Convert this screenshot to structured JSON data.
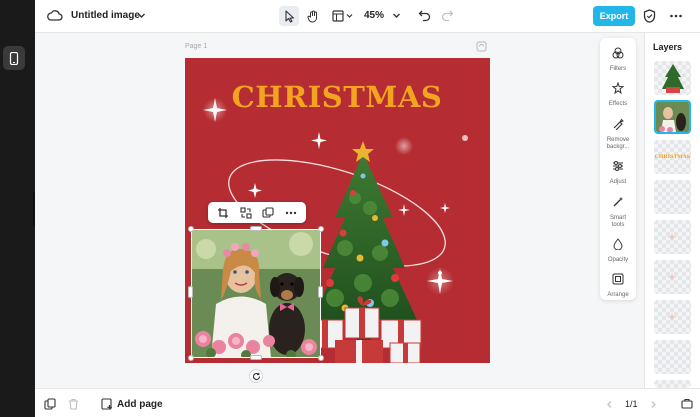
{
  "header": {
    "doc_title": "Untitled image",
    "zoom": "45%",
    "export_label": "Export"
  },
  "canvas": {
    "page_label": "Page 1",
    "design_title": "CHRISTMAS"
  },
  "tools": [
    {
      "label": "Filters",
      "icon": "filters-icon"
    },
    {
      "label": "Effects",
      "icon": "effects-icon"
    },
    {
      "label": "Remove backgr...",
      "icon": "remove-background-icon"
    },
    {
      "label": "Adjust",
      "icon": "adjust-icon"
    },
    {
      "label": "Smart tools",
      "icon": "smart-tools-icon"
    },
    {
      "label": "Opacity",
      "icon": "opacity-icon"
    },
    {
      "label": "Arrange",
      "icon": "arrange-icon"
    }
  ],
  "layers": {
    "title": "Layers",
    "items": [
      {
        "name": "christmas-tree"
      },
      {
        "name": "bride-and-dog-photo",
        "selected": true
      },
      {
        "name": "christmas-text",
        "text": "CHRISTMAS"
      },
      {
        "name": "empty-layer"
      },
      {
        "name": "sparkle-layer"
      },
      {
        "name": "sparkle-layer"
      },
      {
        "name": "sparkle-layer"
      },
      {
        "name": "empty-layer"
      },
      {
        "name": "empty-layer"
      }
    ]
  },
  "footer": {
    "add_page": "Add page",
    "pager": "1/1"
  },
  "colors": {
    "accent": "#22b7e8",
    "design_background": "#b52d33",
    "title_gold": "#f2a320"
  }
}
